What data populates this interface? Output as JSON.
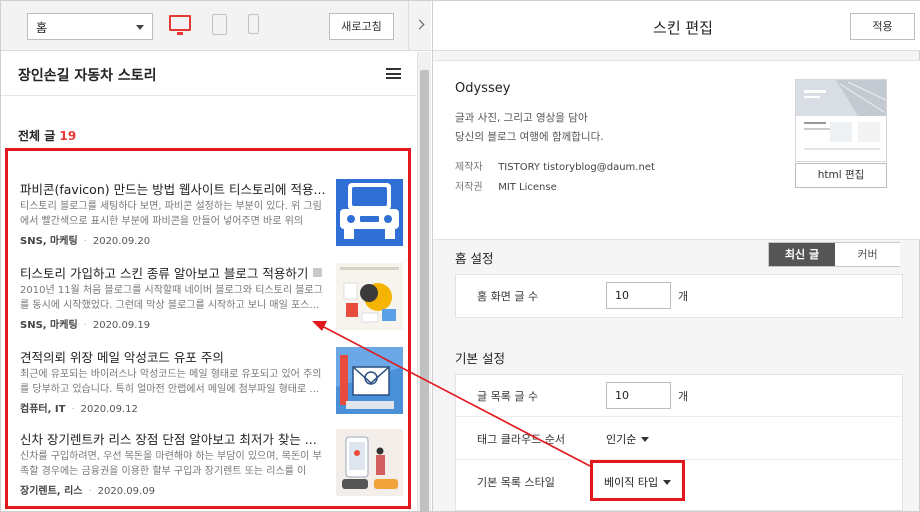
{
  "preview": {
    "page_select": "홈",
    "refresh_label": "새로고침",
    "blog_title": "장인손길 자동차 스토리",
    "total_label": "전체 글",
    "total_count": "19",
    "posts": [
      {
        "title": "파비콘(favicon) 만드는 방법 웹사이트 티스토리에 적용...",
        "excerpt": "티스토리 블로그를 세팅하다 보면, 파비콘 설정하는 부분이 있다. 위 그림에서 빨간색으로 표시한 부분에 파비콘을 만들어 넣어주면 바로 위의 아...",
        "category": "SNS, 마케팅",
        "date": "2020.09.20"
      },
      {
        "title": "티스토리 가입하고 스킨 종류 알아보고 블로그 적용하기",
        "excerpt": "2010년 11월 처음 블로그를 시작할때 네이버 블로그와 티스토리 블로그를 동시에 시작했었다. 그런데 막상 블로그를 시작하고 보니 매일 포스...",
        "category": "SNS, 마케팅",
        "date": "2020.09.19"
      },
      {
        "title": "견적의뢰 위장 메일 악성코드 유포 주의",
        "excerpt": "최근에 유포되는 바이러스나 악성코드는 메일 형태로 유포되고 있어 주의를 당부하고 있습니다. 특히 얼마전 안랩에서 메일에 첨부파일 형태로 ...",
        "category": "컴퓨터, IT",
        "date": "2020.09.12"
      },
      {
        "title": "신차 장기렌트카 리스 장점 단점 알아보고 최저가 찾는 ...",
        "excerpt": "신차를 구입하려면, 우선 목돈을 마련해야 하는 부담이 있으며, 목돈이 부족할 경우에는 금융권을 이용한 할부 구입과 장기렌트 또는 리스를 이용...",
        "category": "장기렌트, 리스",
        "date": "2020.09.09"
      }
    ]
  },
  "editor": {
    "title": "스킨 편집",
    "apply_label": "적용",
    "skin_name": "Odyssey",
    "skin_desc_1": "글과 사진, 그리고 영상을 담아",
    "skin_desc_2": "당신의 블로그 여행에 함께합니다.",
    "author_key": "제작자",
    "author_value": "TISTORY tistoryblog@daum.net",
    "license_key": "저작권",
    "license_value": "MIT License",
    "html_edit_label": "html 편집",
    "home_section": "홈 설정",
    "seg_latest": "최신 글",
    "seg_cover": "커버",
    "home_post_count_label": "홈 화면 글 수",
    "home_post_count": "10",
    "unit": "개",
    "basic_section": "기본 설정",
    "list_count_label": "글 목록 글 수",
    "list_count": "10",
    "tag_cloud_label": "태그 클라우드 순서",
    "tag_cloud_value": "인기순",
    "list_style_label": "기본 목록 스타일",
    "list_style_value": "베이직 타입"
  },
  "colors": {
    "highlight": "#e1181e",
    "accent_red": "#e53935"
  }
}
